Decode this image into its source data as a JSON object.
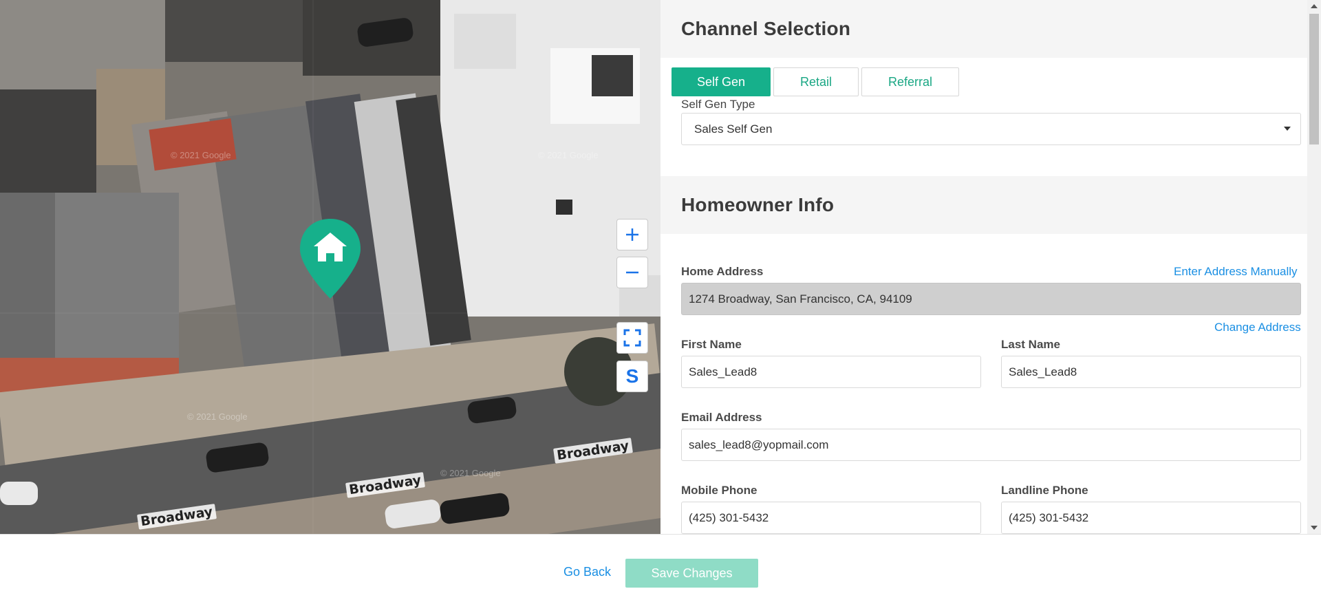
{
  "map": {
    "street_labels": [
      "Broadway",
      "Broadway",
      "Broadway"
    ],
    "watermark": "© 2021 Google",
    "controls": {
      "zoom_in": "+",
      "zoom_out": "−",
      "street_view": "S"
    },
    "marker_icon": "house-icon",
    "accent_color": "#16b08b"
  },
  "channel": {
    "title": "Channel Selection",
    "tabs": [
      {
        "label": "Self Gen",
        "active": true
      },
      {
        "label": "Retail",
        "active": false
      },
      {
        "label": "Referral",
        "active": false
      }
    ],
    "type_label": "Self Gen Type",
    "type_value": "Sales Self Gen"
  },
  "homeowner": {
    "title": "Homeowner Info",
    "address_label": "Home Address",
    "enter_manually": "Enter Address Manually",
    "address_value": "1274 Broadway, San Francisco, CA, 94109",
    "change_address": "Change Address",
    "first_name_label": "First Name",
    "first_name": "Sales_Lead8",
    "last_name_label": "Last Name",
    "last_name": "Sales_Lead8",
    "email_label": "Email Address",
    "email": "sales_lead8@yopmail.com",
    "mobile_label": "Mobile Phone",
    "mobile": "(425) 301-5432",
    "landline_label": "Landline Phone",
    "landline": "(425) 301-5432"
  },
  "footer": {
    "go_back": "Go Back",
    "save": "Save Changes"
  }
}
